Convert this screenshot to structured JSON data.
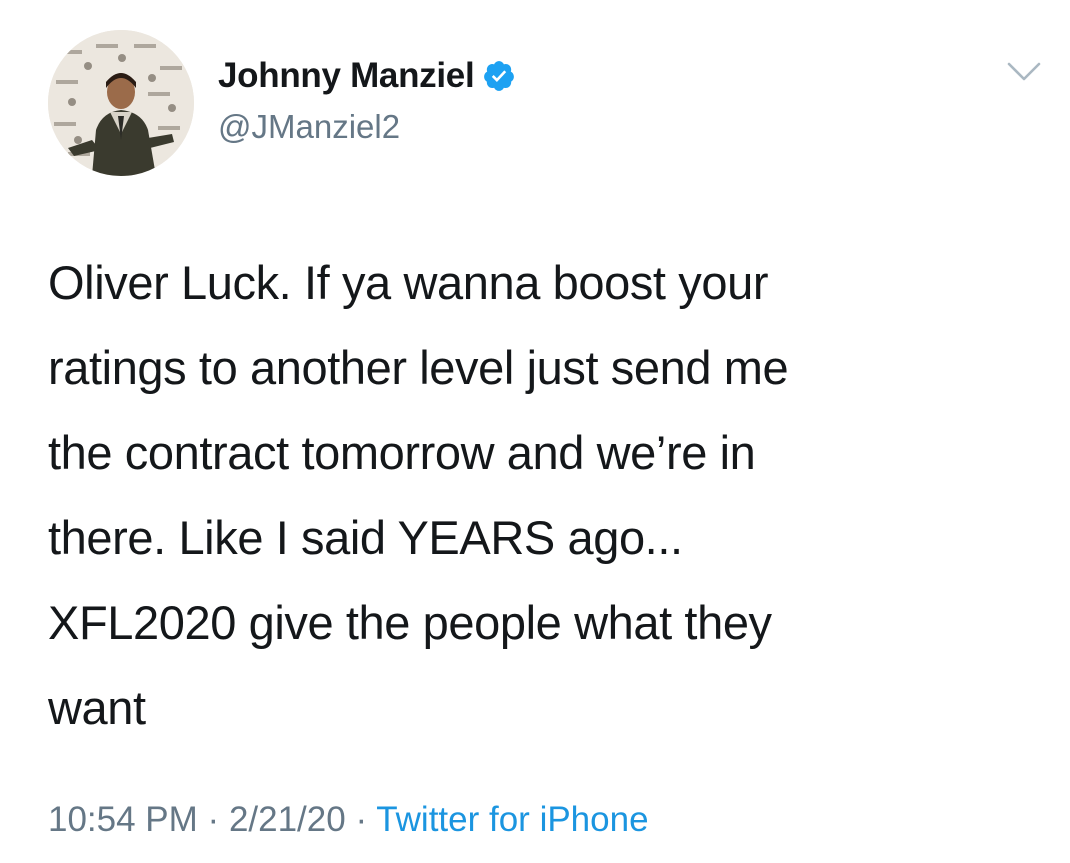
{
  "tweet": {
    "author": {
      "display_name": "Johnny Manziel",
      "handle": "@JManziel2",
      "verified": true,
      "avatar_icon": "profile-photo"
    },
    "text_lines": [
      "Oliver Luck. If ya wanna boost your",
      "ratings to another level just send me",
      "the contract tomorrow and we’re in",
      "there. Like I said YEARS ago...",
      "XFL2020 give the people what they",
      "want"
    ],
    "time": "10:54 PM",
    "separator": "·",
    "date": "2/21/20",
    "source": "Twitter for iPhone",
    "menu_icon": "chevron-down-icon"
  },
  "colors": {
    "text": "#14171a",
    "secondary": "#657786",
    "accent": "#1b95e0",
    "background": "#ffffff"
  }
}
